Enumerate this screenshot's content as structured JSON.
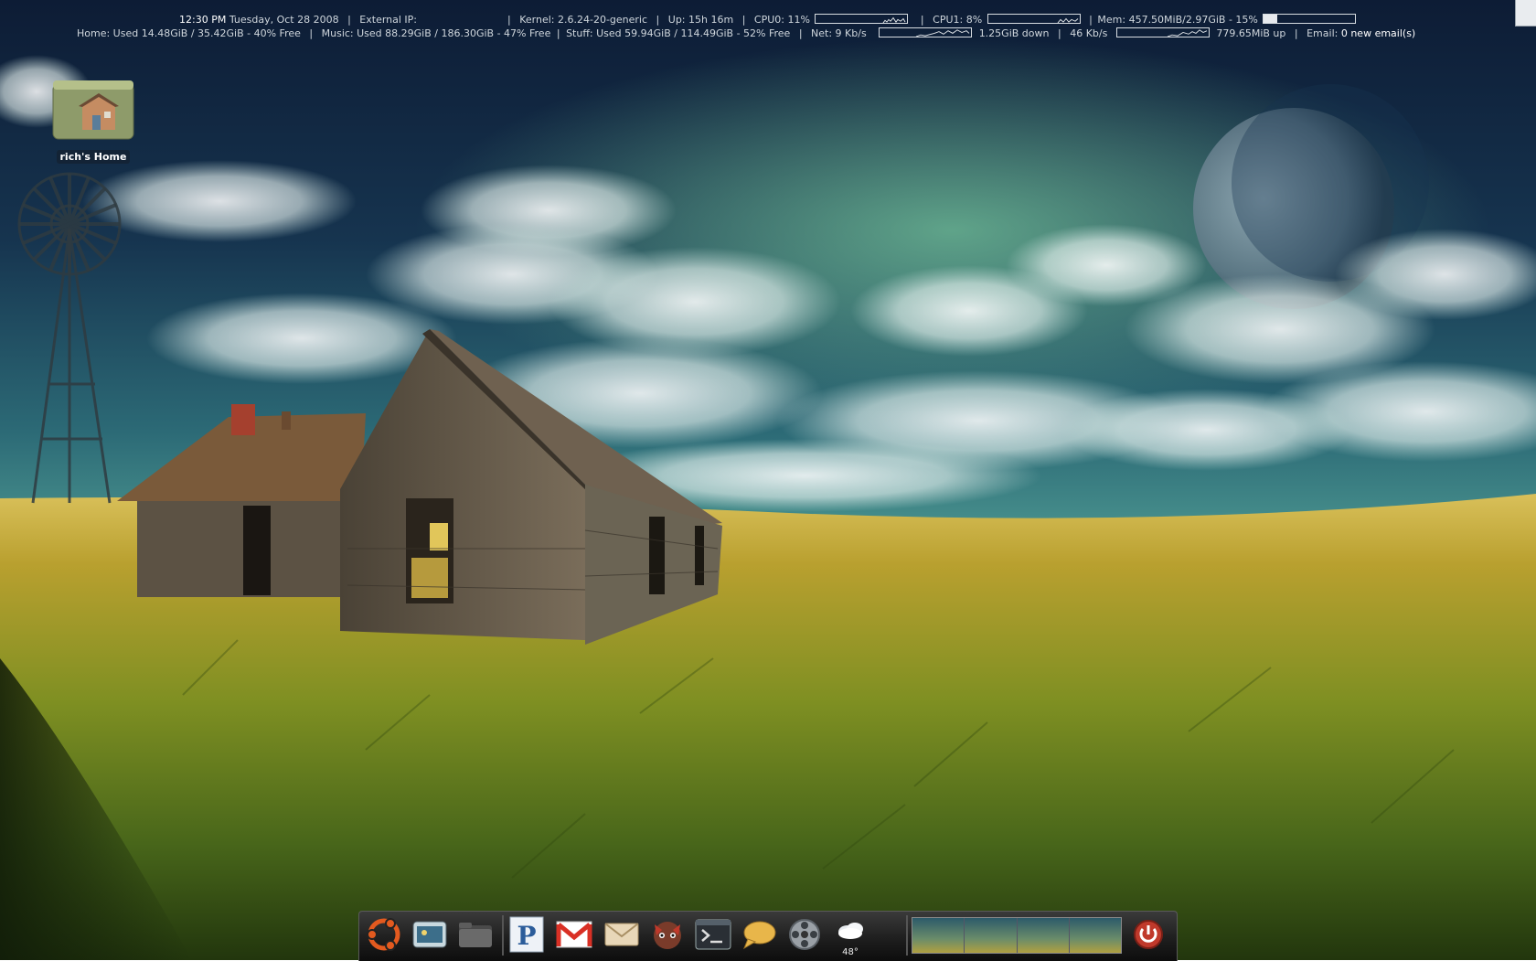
{
  "conky": {
    "time": "12:30 PM",
    "date": "Tuesday, Oct 28 2008",
    "external_ip_label": "External IP:",
    "kernel": "Kernel: 2.6.24-20-generic",
    "uptime": "Up: 15h 16m",
    "cpu0_label": "CPU0: 11%",
    "cpu0_value": 11,
    "cpu1_label": "CPU1: 8%",
    "cpu1_value": 8,
    "mem_label": "Mem: 457.50MiB/2.97GiB - 15%",
    "mem_value": 15,
    "home": "Home: Used 14.48GiB  / 35.42GiB  - 40% Free",
    "music": "Music: Used 88.29GiB  / 186.30GiB  - 47% Free",
    "stuff": "Stuff: Used 59.94GiB  / 114.49GiB  - 52% Free",
    "net_down_label": "Net: 9 Kb/s",
    "down_total": "1.25GiB down",
    "net_up_label": "46 Kb/s",
    "up_total": "779.65MiB up",
    "email_label": "Email:",
    "email_value": "0 new email(s)"
  },
  "desktop": {
    "home_icon_label": "rich's Home"
  },
  "dock": {
    "items": [
      {
        "name": "ubuntu-menu-icon"
      },
      {
        "name": "screenshot-app-icon"
      },
      {
        "name": "folder-icon"
      },
      {
        "name": "pidgin-p-icon"
      },
      {
        "name": "gmail-icon"
      },
      {
        "name": "mail-envelope-icon"
      },
      {
        "name": "firefox-icon"
      },
      {
        "name": "terminal-icon"
      },
      {
        "name": "chat-bubble-icon"
      },
      {
        "name": "film-reel-icon"
      },
      {
        "name": "weather-cloud-icon"
      }
    ],
    "weather_temp": "48°",
    "workspaces": 4
  },
  "colors": {
    "sky_top": "#0f2340",
    "sky_mid": "#2d6f79",
    "grass": "#b8a23a",
    "dock": "#1c1c1c"
  }
}
